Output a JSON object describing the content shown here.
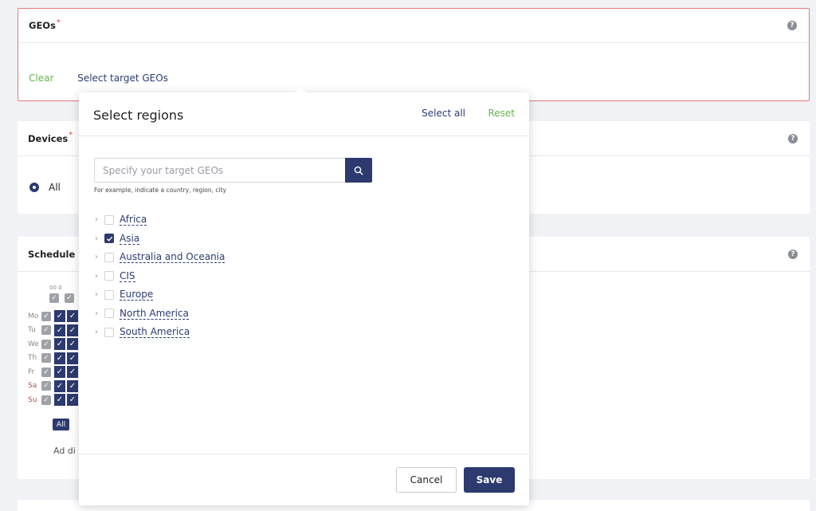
{
  "geos": {
    "title": "GEOs",
    "required_mark": "*",
    "help_icon": "?",
    "clear_label": "Clear",
    "select_label": "Select target GEOs"
  },
  "devices": {
    "title": "Devices",
    "required_mark": "*",
    "help_icon": "?",
    "option_label": "All"
  },
  "schedule": {
    "title": "Schedule",
    "help_icon": "?",
    "hours_label": "00 0",
    "days": [
      "Mo",
      "Tu",
      "We",
      "Th",
      "Fr",
      "Sa",
      "Su"
    ],
    "all_button": "All",
    "ad_text": "Ad di"
  },
  "popup": {
    "title": "Select regions",
    "select_all": "Select all",
    "reset": "Reset",
    "search_placeholder": "Specify your target GEOs",
    "hint": "For example, indicate a country, region, city",
    "regions": [
      {
        "name": "Africa",
        "checked": false
      },
      {
        "name": "Asia",
        "checked": true
      },
      {
        "name": "Australia and Oceania",
        "checked": false
      },
      {
        "name": "CIS",
        "checked": false
      },
      {
        "name": "Europe",
        "checked": false
      },
      {
        "name": "North America",
        "checked": false
      },
      {
        "name": "South America",
        "checked": false
      }
    ],
    "cancel_label": "Cancel",
    "save_label": "Save"
  },
  "colors": {
    "navy": "#2c3a6f",
    "green_link": "#62b54a",
    "error_border": "#e6787a"
  }
}
